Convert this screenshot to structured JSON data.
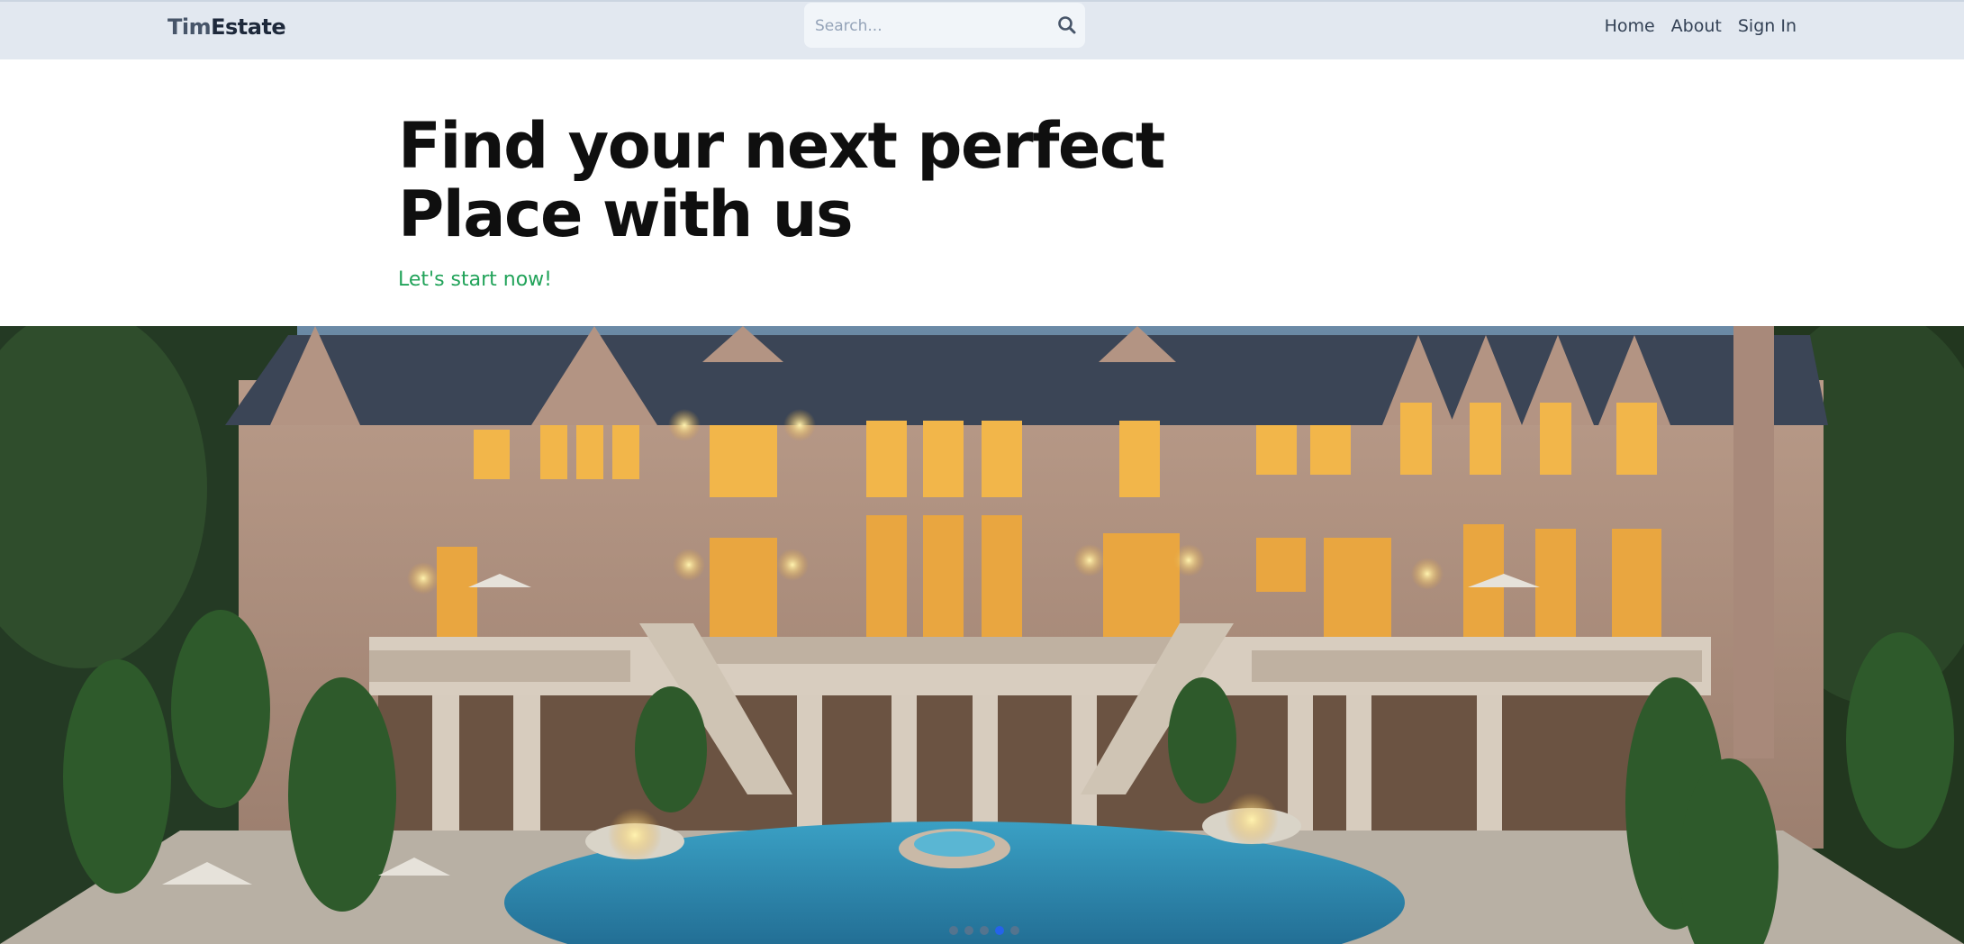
{
  "header": {
    "logo_part1": "Tim",
    "logo_part2": "Estate",
    "search_placeholder": "Search...",
    "nav": [
      "Home",
      "About",
      "Sign In"
    ]
  },
  "hero": {
    "title_line1": "Find your next perfect",
    "title_line2": "Place with us",
    "cta": "Let's start now!"
  },
  "carousel": {
    "slide_count": 5,
    "active_index": 3,
    "image": "mansion-with-pool"
  },
  "colors": {
    "nav_bg": "#e2e8f0",
    "cta": "#22a35a",
    "active_dot": "#2563eb"
  }
}
